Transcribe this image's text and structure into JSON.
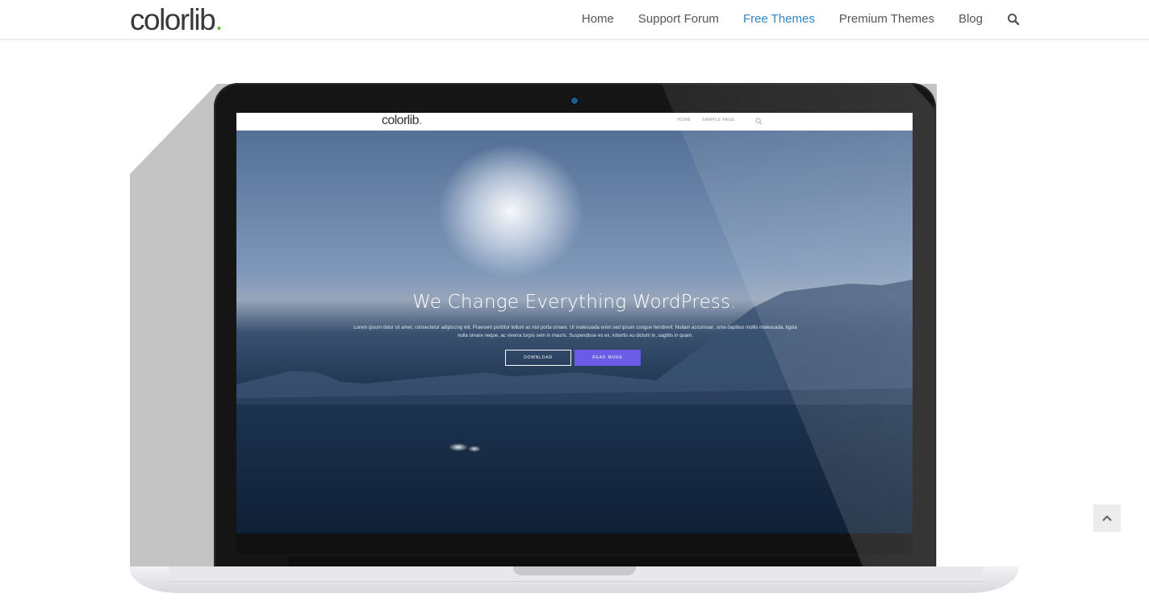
{
  "header": {
    "logo_text": "colorlib",
    "logo_dot": ".",
    "nav": [
      {
        "label": "Home",
        "active": false
      },
      {
        "label": "Support Forum",
        "active": false
      },
      {
        "label": "Free Themes",
        "active": true
      },
      {
        "label": "Premium Themes",
        "active": false
      },
      {
        "label": "Blog",
        "active": false
      }
    ],
    "search_icon": "search-icon",
    "active_color": "#2f86c2"
  },
  "mockup": {
    "screen": {
      "logo_text": "colorlib",
      "logo_dot": ".",
      "nav": [
        "HOME",
        "SAMPLE PAGE"
      ],
      "search_icon": "search-icon",
      "hero_title": "We Change Everything WordPress.",
      "hero_text": "Lorem ipsum dolor sit amet, consectetur adipiscing elit. Praesent porttitor tellum ac nisl porta ornare. Ut malesuada enim sed ipsum congue hendrerit. Nullam accumsan, urna dapibus mollis malesuada, ligula nulla ornare neque, ac viverra turpis sem in mauris. Suspendisse ex ex, lobortis eu dictum in, sagittis in quam.",
      "download_label": "DOWNLOAD",
      "read_more_label": "READ MORE",
      "read_more_color": "#6b5ce7"
    }
  },
  "back_to_top_icon": "chevron-up-icon"
}
